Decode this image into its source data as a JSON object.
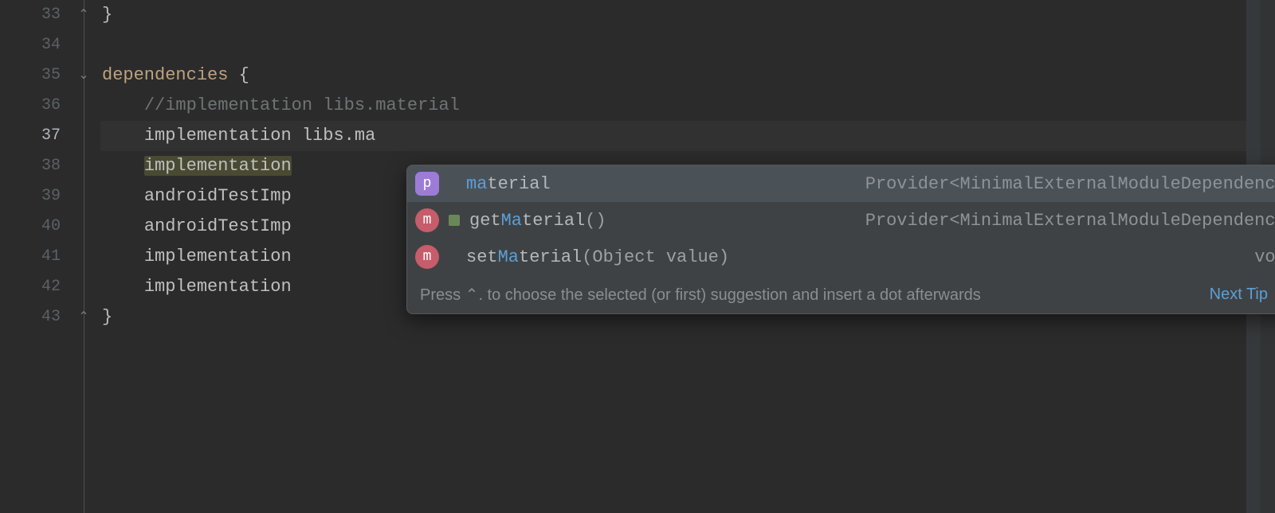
{
  "gutter": {
    "start": 33,
    "end": 43,
    "active": 37
  },
  "code": {
    "l33": "}",
    "l34": "",
    "l35_kw": "dependencies",
    "l35_brace": " {",
    "l36_indent": "    ",
    "l36_comment": "//implementation libs.material",
    "l37_indent": "    ",
    "l37_a": "implementation ",
    "l37_b": "libs.ma",
    "l38_indent": "    ",
    "l38_a": "implementation",
    "l39_indent": "    ",
    "l39_a": "androidTestImp",
    "l40_indent": "    ",
    "l40_a": "androidTestImp",
    "l41_indent": "    ",
    "l41_a": "implementation",
    "l42_indent": "    ",
    "l42_a": "implementation",
    "l43": "}"
  },
  "popup": {
    "rows": [
      {
        "badge": "p",
        "badgeClass": "p",
        "sub": "",
        "match": "ma",
        "rest": "terial",
        "sig": "",
        "type": "Provider<MinimalExternalModuleDependency>",
        "selected": true
      },
      {
        "badge": "m",
        "badgeClass": "m",
        "sub": "rw",
        "pre": "get",
        "match": "Ma",
        "rest": "terial",
        "sig": "()",
        "type": "Provider<MinimalExternalModuleDependency>",
        "selected": false
      },
      {
        "badge": "m",
        "badgeClass": "m",
        "sub": "",
        "pre": "set",
        "match": "Ma",
        "rest": "terial",
        "sig": "(Object value)",
        "type": "void",
        "selected": false
      }
    ],
    "footer_hint": "Press ⌃. to choose the selected (or first) suggestion and insert a dot afterwards",
    "next_tip": "Next Tip"
  }
}
